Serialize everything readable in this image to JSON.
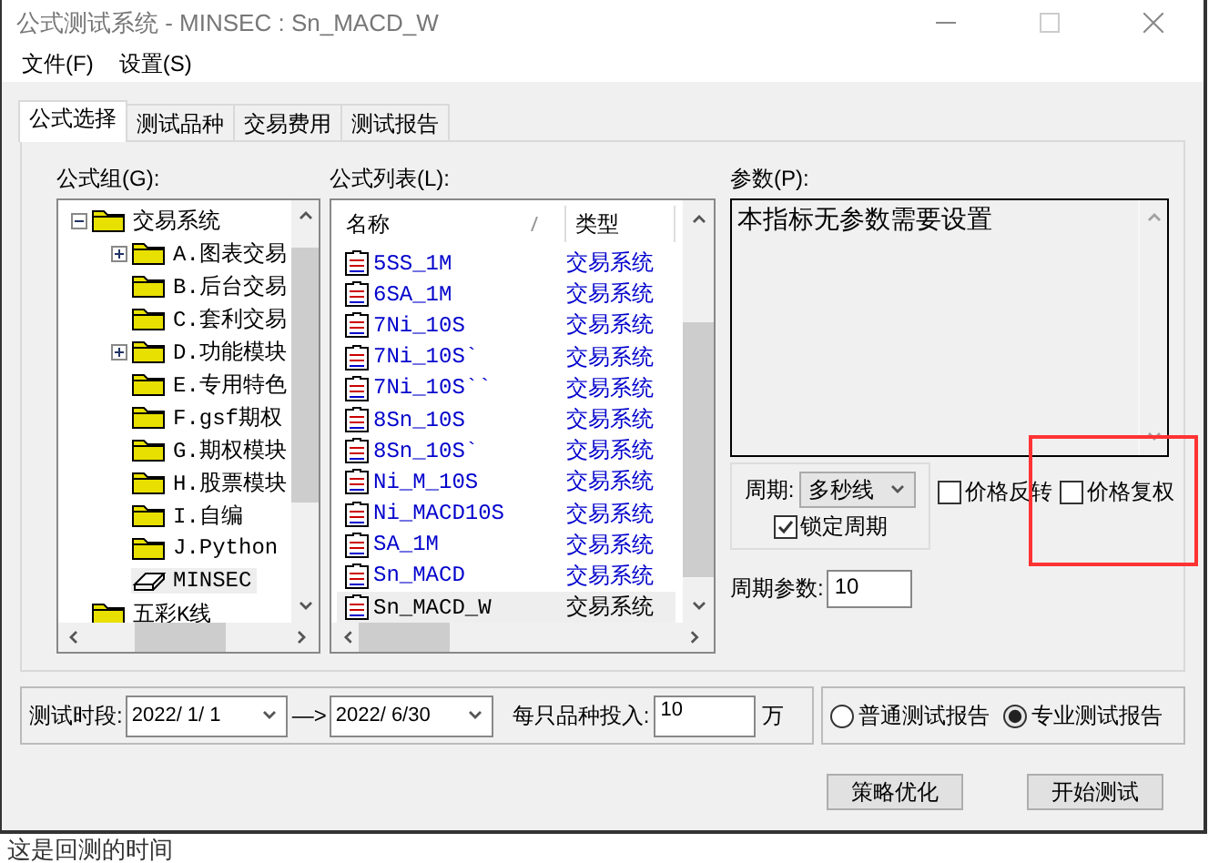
{
  "window": {
    "title": "公式测试系统 - MINSEC : Sn_MACD_W"
  },
  "menu": [
    "文件(F)",
    "设置(S)"
  ],
  "tabs": [
    {
      "label": "公式选择",
      "selected": true
    },
    {
      "label": "测试品种",
      "selected": false
    },
    {
      "label": "交易费用",
      "selected": false
    },
    {
      "label": "测试报告",
      "selected": false
    }
  ],
  "formula_groups": {
    "label": "公式组(G):",
    "tree": [
      {
        "label": "交易系统",
        "kind": "folder",
        "expandable": true,
        "expanded": true,
        "selected": false,
        "children": [
          {
            "label": "A.图表交易",
            "kind": "folder",
            "expandable": true,
            "expanded": false,
            "selected": false
          },
          {
            "label": "B.后台交易",
            "kind": "folder",
            "expandable": false,
            "expanded": false,
            "selected": false
          },
          {
            "label": "C.套利交易",
            "kind": "folder",
            "expandable": false,
            "expanded": false,
            "selected": false
          },
          {
            "label": "D.功能模块",
            "kind": "folder",
            "expandable": true,
            "expanded": false,
            "selected": false
          },
          {
            "label": "E.专用特色",
            "kind": "folder",
            "expandable": false,
            "expanded": false,
            "selected": false
          },
          {
            "label": "F.gsf期权",
            "kind": "folder",
            "expandable": false,
            "expanded": false,
            "selected": false
          },
          {
            "label": "G.期权模块",
            "kind": "folder",
            "expandable": false,
            "expanded": false,
            "selected": false
          },
          {
            "label": "H.股票模块",
            "kind": "folder",
            "expandable": false,
            "expanded": false,
            "selected": false
          },
          {
            "label": "I.自编",
            "kind": "folder",
            "expandable": false,
            "expanded": false,
            "selected": false
          },
          {
            "label": "J.Python",
            "kind": "folder",
            "expandable": false,
            "expanded": false,
            "selected": false
          },
          {
            "label": "MINSEC",
            "kind": "formula",
            "expandable": false,
            "expanded": false,
            "selected": true
          }
        ]
      },
      {
        "label": "五彩K线",
        "kind": "folder",
        "expandable": false,
        "expanded": false,
        "selected": false
      }
    ]
  },
  "formula_list": {
    "label": "公式列表(L):",
    "columns": [
      "名称",
      "类型"
    ],
    "rows": [
      {
        "name": "5SS_1M",
        "type": "交易系统",
        "selected": false
      },
      {
        "name": "6SA_1M",
        "type": "交易系统",
        "selected": false
      },
      {
        "name": "7Ni_10S",
        "type": "交易系统",
        "selected": false
      },
      {
        "name": "7Ni_10S`",
        "type": "交易系统",
        "selected": false
      },
      {
        "name": "7Ni_10S``",
        "type": "交易系统",
        "selected": false
      },
      {
        "name": "8Sn_10S",
        "type": "交易系统",
        "selected": false
      },
      {
        "name": "8Sn_10S`",
        "type": "交易系统",
        "selected": false
      },
      {
        "name": "Ni_M_10S",
        "type": "交易系统",
        "selected": false
      },
      {
        "name": "Ni_MACD10S",
        "type": "交易系统",
        "selected": false
      },
      {
        "name": "SA_1M",
        "type": "交易系统",
        "selected": false
      },
      {
        "name": "Sn_MACD",
        "type": "交易系统",
        "selected": false
      },
      {
        "name": "Sn_MACD_W",
        "type": "交易系统",
        "selected": true
      }
    ]
  },
  "params": {
    "label": "参数(P):",
    "text": "本指标无参数需要设置",
    "period": {
      "label": "周期:",
      "value": "多秒线"
    },
    "lock_period": {
      "label": "锁定周期",
      "checked": true
    },
    "options": [
      {
        "label": "价格反转",
        "checked": false
      },
      {
        "label": "价格复权",
        "checked": false
      }
    ],
    "period_param": {
      "label": "周期参数:",
      "value": "10"
    }
  },
  "test_range": {
    "label": "测试时段:",
    "start": "2022/ 1/ 1",
    "arrow": "—>",
    "end": "2022/ 6/30",
    "invest_label": "每只品种投入:",
    "invest_value": "10",
    "unit": "万"
  },
  "report_types": [
    {
      "label": "普通测试报告",
      "selected": false
    },
    {
      "label": "专业测试报告",
      "selected": true
    }
  ],
  "buttons": [
    "策略优化",
    "开始测试"
  ],
  "caption": "这是回测的时间"
}
